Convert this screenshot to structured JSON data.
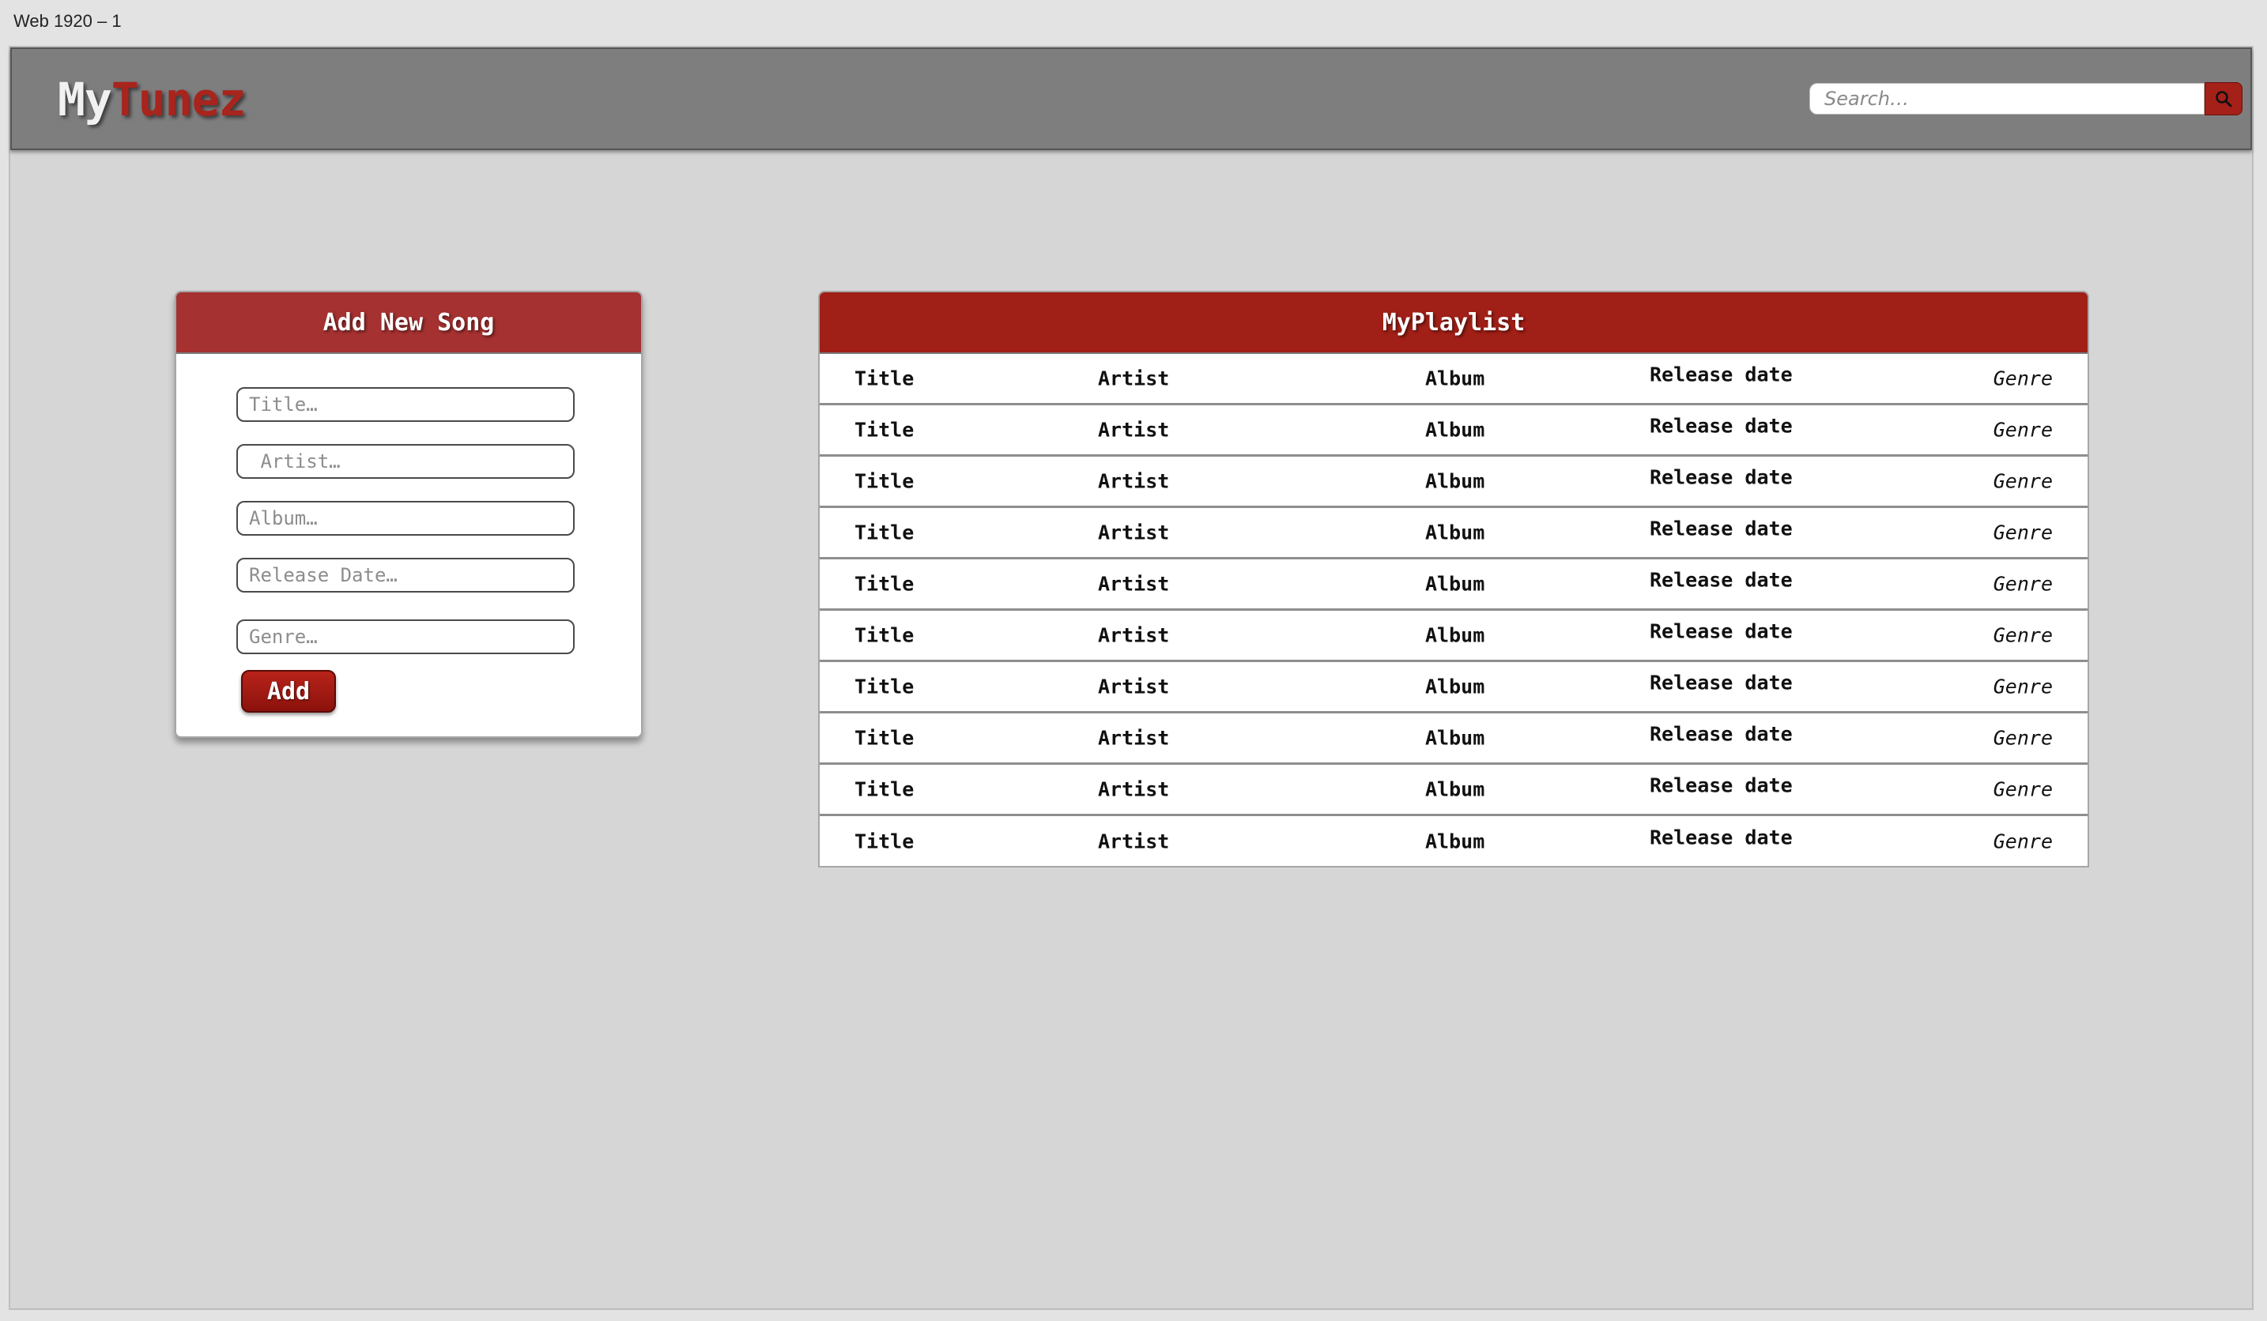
{
  "frame": {
    "label": "Web 1920 – 1"
  },
  "header": {
    "logo": {
      "part1": "My",
      "part2": "Tunez"
    },
    "search": {
      "placeholder": "Search…",
      "icon": "search-icon"
    }
  },
  "add_song": {
    "title": "Add New Song",
    "fields": {
      "title_placeholder": "Title…",
      "artist_placeholder": " Artist…",
      "album_placeholder": "Album…",
      "release_date_placeholder": "Release Date…",
      "genre_placeholder": "Genre…"
    },
    "add_label": "Add"
  },
  "playlist": {
    "title": "MyPlaylist",
    "rows": [
      {
        "title": "Title",
        "artist": "Artist",
        "album": "Album",
        "release_date": "Release date",
        "genre": "Genre"
      },
      {
        "title": "Title",
        "artist": "Artist",
        "album": "Album",
        "release_date": "Release date",
        "genre": "Genre"
      },
      {
        "title": "Title",
        "artist": "Artist",
        "album": "Album",
        "release_date": "Release date",
        "genre": "Genre"
      },
      {
        "title": "Title",
        "artist": "Artist",
        "album": "Album",
        "release_date": "Release date",
        "genre": "Genre"
      },
      {
        "title": "Title",
        "artist": "Artist",
        "album": "Album",
        "release_date": "Release date",
        "genre": "Genre"
      },
      {
        "title": "Title",
        "artist": "Artist",
        "album": "Album",
        "release_date": "Release date",
        "genre": "Genre"
      },
      {
        "title": "Title",
        "artist": "Artist",
        "album": "Album",
        "release_date": "Release date",
        "genre": "Genre"
      },
      {
        "title": "Title",
        "artist": "Artist",
        "album": "Album",
        "release_date": "Release date",
        "genre": "Genre"
      },
      {
        "title": "Title",
        "artist": "Artist",
        "album": "Album",
        "release_date": "Release date",
        "genre": "Genre"
      },
      {
        "title": "Title",
        "artist": "Artist",
        "album": "Album",
        "release_date": "Release date",
        "genre": "Genre"
      }
    ]
  },
  "colors": {
    "brand_red": "#a01f17",
    "header_gray": "#7f7e7f",
    "background": "#d6d6d6"
  }
}
